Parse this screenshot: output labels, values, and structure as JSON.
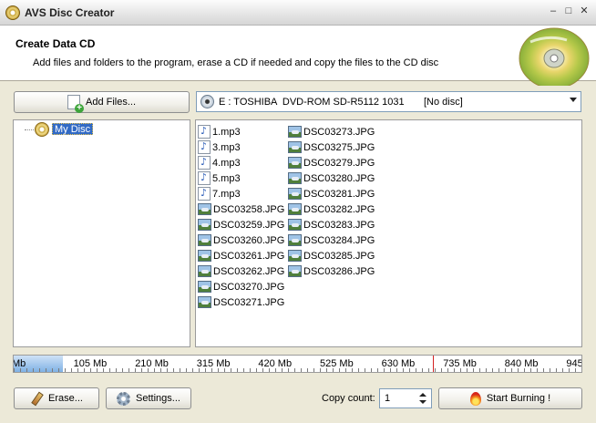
{
  "window": {
    "title": "AVS Disc Creator"
  },
  "header": {
    "title": "Create Data CD",
    "subtitle": "Add files and folders to the program, erase a CD if needed and copy the files to the CD disc"
  },
  "toolbar": {
    "add_files_label": "Add Files...",
    "drive_text": "E : TOSHIBA  DVD-ROM SD-R5112 1031       [No disc]"
  },
  "tree": {
    "root_label": "My Disc"
  },
  "files": {
    "column1": [
      "1.mp3",
      "3.mp3",
      "4.mp3",
      "5.mp3",
      "7.mp3",
      "DSC03258.JPG",
      "DSC03259.JPG",
      "DSC03260.JPG",
      "DSC03261.JPG",
      "DSC03262.JPG",
      "DSC03270.JPG",
      "DSC03271.JPG"
    ],
    "column1_types": [
      "mp3",
      "mp3",
      "mp3",
      "mp3",
      "mp3",
      "jpg",
      "jpg",
      "jpg",
      "jpg",
      "jpg",
      "jpg",
      "jpg"
    ],
    "column2": [
      "DSC03273.JPG",
      "DSC03275.JPG",
      "DSC03279.JPG",
      "DSC03280.JPG",
      "DSC03281.JPG",
      "DSC03282.JPG",
      "DSC03283.JPG",
      "DSC03284.JPG",
      "DSC03285.JPG",
      "DSC03286.JPG"
    ]
  },
  "capacity": {
    "ticks": [
      "Mb",
      "105 Mb",
      "210 Mb",
      "315 Mb",
      "420 Mb",
      "525 Mb",
      "630 Mb",
      "735 Mb",
      "840 Mb",
      "945 Mb"
    ],
    "used_mb": 40,
    "limit_mb": 700,
    "max_mb": 945,
    "used_color": "#7fb1e5",
    "limit_color": "#d42222"
  },
  "footer": {
    "erase_label": "Erase...",
    "settings_label": "Settings...",
    "copy_count_label": "Copy count:",
    "copy_count_value": "1",
    "burn_label": "Start Burning !"
  },
  "icons": {
    "app": "disc-icon",
    "add_files": "add-file-icon",
    "drive": "cd-drive-icon",
    "mp3": "audio-file-icon",
    "jpg": "image-file-icon",
    "erase": "pencil-eraser-icon",
    "settings": "gear-icon",
    "burn": "flame-icon"
  }
}
